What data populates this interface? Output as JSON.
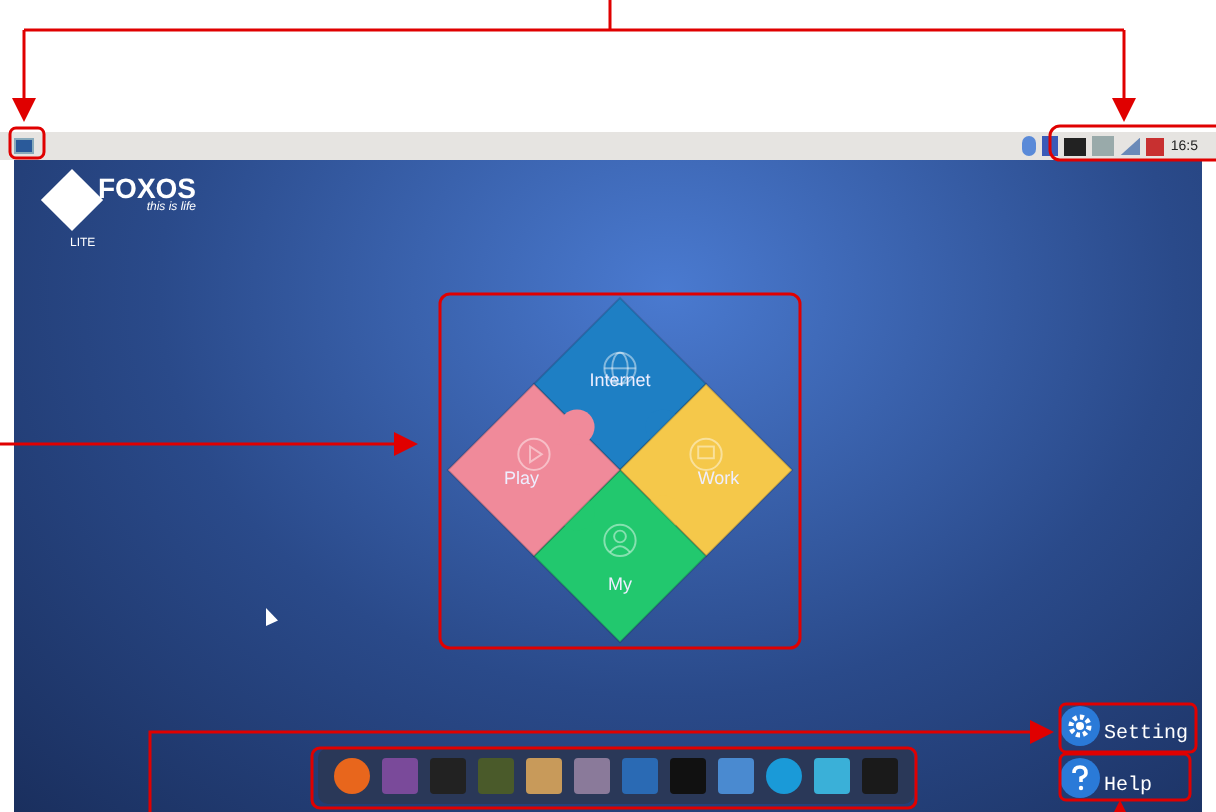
{
  "top_panel": {
    "clock": "16:5"
  },
  "logo": {
    "name": "FOXOS",
    "tagline": "this is life",
    "badge": "LITE"
  },
  "puzzle": [
    {
      "label": "Internet",
      "color": "#1e7fc4"
    },
    {
      "label": "Work",
      "color": "#f5c84a"
    },
    {
      "label": "My",
      "color": "#22c86e"
    },
    {
      "label": "Play",
      "color": "#f08a9a"
    }
  ],
  "desktop_buttons": [
    {
      "kind": "settings",
      "label": "Setting"
    },
    {
      "kind": "help",
      "label": "Help"
    }
  ]
}
